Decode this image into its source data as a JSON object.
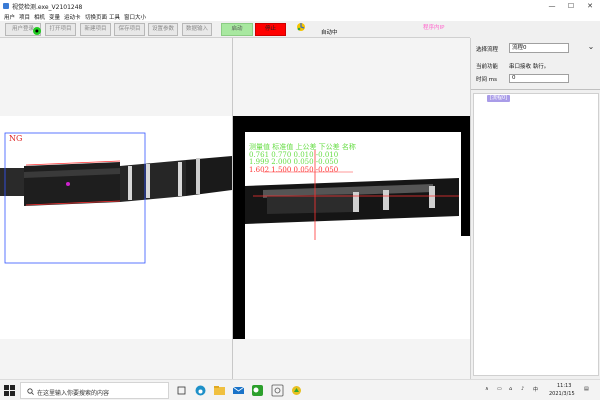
{
  "window": {
    "title": "视觉检测.exe_V2101248",
    "controls": [
      "—",
      "☐",
      "✕"
    ]
  },
  "menu": [
    "用户",
    "项目",
    "相机",
    "变量",
    "运动卡",
    "切换页面",
    "工具",
    "窗口大小"
  ],
  "toolbar": {
    "user_login": "用户登录",
    "open_project": "打开项目",
    "new_project": "新建项目",
    "save_project": "保存项目",
    "set_params": "设置参数",
    "data_input": "数据输入",
    "start": "启动",
    "stop": "停止",
    "auto_status": "自动中",
    "program_label": "程序内IP"
  },
  "colors": {
    "start_button": "#a8e8a0",
    "stop_button": "#ff0000",
    "program_label": "#ff66cc",
    "flow_node": "#a99ce8",
    "ng_text": "#dd2222",
    "roi_box": "#3355ff",
    "overlay_text": "#66dd44"
  },
  "left_view": {
    "result": "NG"
  },
  "right_view": {
    "measure_table": {
      "headers": "测量值 标准值 上公差 下公差 名称",
      "rows": [
        "0.761  0.770  0.010  -0.010",
        "1.999  2.000  0.050  -0.050",
        "1.602  1.500  0.050  -0.050"
      ]
    }
  },
  "right_panel": {
    "flow_label": "选择流程",
    "flow_value": "流程0",
    "current_func_label": "当前功能",
    "current_func_value": "串口接收 執行。",
    "time_label": "时间 ms",
    "time_value": "0",
    "flow_node": "[流程0]"
  },
  "taskbar": {
    "search_placeholder": "在这里输入你要搜索的内容",
    "time": "11:13",
    "date": "2021/3/15",
    "ime": "中"
  }
}
